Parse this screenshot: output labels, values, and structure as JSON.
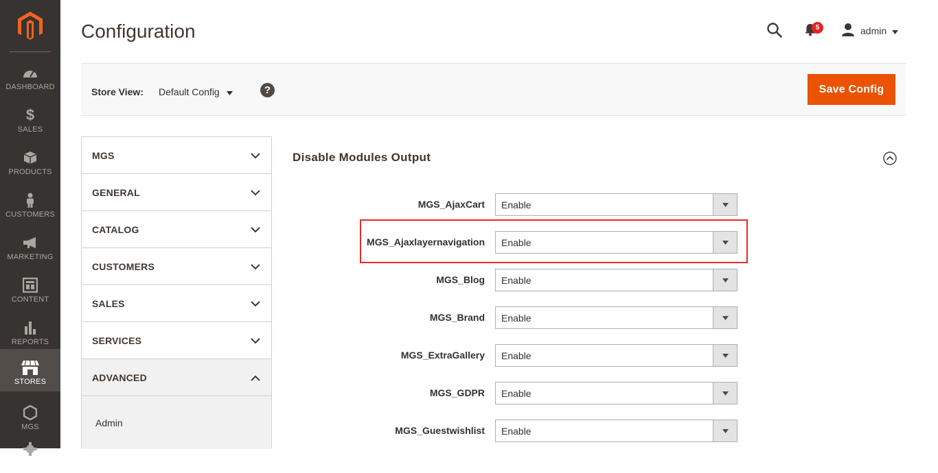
{
  "nav": {
    "items": [
      {
        "label": "DASHBOARD"
      },
      {
        "label": "SALES"
      },
      {
        "label": "PRODUCTS"
      },
      {
        "label": "CUSTOMERS"
      },
      {
        "label": "MARKETING"
      },
      {
        "label": "CONTENT"
      },
      {
        "label": "REPORTS"
      },
      {
        "label": "STORES"
      },
      {
        "label": "MGS"
      }
    ],
    "active": "STORES"
  },
  "header": {
    "title": "Configuration",
    "notification_count": "5",
    "user": "admin"
  },
  "store_view": {
    "label": "Store View:",
    "value": "Default Config",
    "help": "?"
  },
  "toolbar": {
    "save_label": "Save Config"
  },
  "tabs": {
    "items": [
      {
        "label": "MGS"
      },
      {
        "label": "GENERAL"
      },
      {
        "label": "CATALOG"
      },
      {
        "label": "CUSTOMERS"
      },
      {
        "label": "SALES"
      },
      {
        "label": "SERVICES"
      },
      {
        "label": "ADVANCED"
      }
    ],
    "open_sub": "Admin"
  },
  "section": {
    "title": "Disable Modules Output",
    "rows": [
      {
        "label": "MGS_AjaxCart",
        "value": "Enable"
      },
      {
        "label": "MGS_Ajaxlayernavigation",
        "value": "Enable"
      },
      {
        "label": "MGS_Blog",
        "value": "Enable"
      },
      {
        "label": "MGS_Brand",
        "value": "Enable"
      },
      {
        "label": "MGS_ExtraGallery",
        "value": "Enable"
      },
      {
        "label": "MGS_GDPR",
        "value": "Enable"
      },
      {
        "label": "MGS_Guestwishlist",
        "value": "Enable"
      }
    ]
  },
  "colors": {
    "nav_bg": "#373330",
    "nav_active": "#524d49",
    "accent": "#eb5202",
    "highlight": "#e02b27",
    "badge": "#e22626"
  }
}
